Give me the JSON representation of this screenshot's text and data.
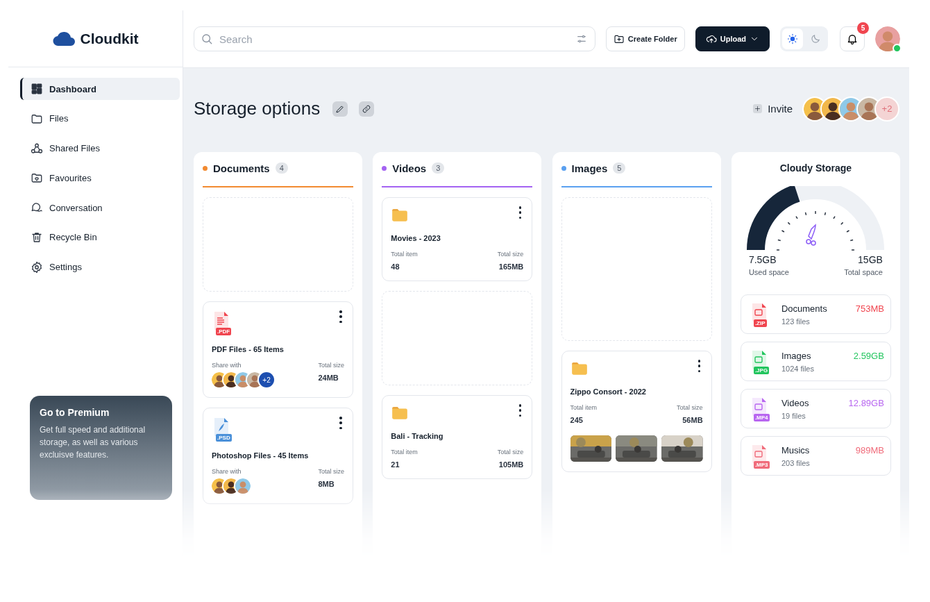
{
  "brand": {
    "name": "Cloudkit"
  },
  "sidebar": {
    "items": [
      {
        "label": "Dashboard",
        "selected": true
      },
      {
        "label": "Files",
        "selected": false
      },
      {
        "label": "Shared Files",
        "selected": false
      },
      {
        "label": "Favourites",
        "selected": false
      },
      {
        "label": "Conversation",
        "selected": false
      },
      {
        "label": "Recycle Bin",
        "selected": false
      },
      {
        "label": "Settings",
        "selected": false
      }
    ]
  },
  "premium": {
    "title": "Go to Premium",
    "text": "Get full speed and additional storage, as well as various excluisve features."
  },
  "search": {
    "placeholder": "Search"
  },
  "actions": [
    {
      "kind": "outline",
      "label": "Create Folder"
    },
    {
      "kind": "primary",
      "label": "Upload"
    }
  ],
  "theme": {
    "options": [
      {
        "kind": "light",
        "selected": true
      },
      {
        "kind": "dark",
        "selected": false
      }
    ]
  },
  "notifications": {
    "count": "5"
  },
  "user": {
    "online": true
  },
  "page": {
    "title": "Storage options",
    "invite": "Invite",
    "members": [
      {
        "kind": "avatar"
      },
      {
        "kind": "avatar"
      },
      {
        "kind": "avatar"
      },
      {
        "kind": "avatar"
      }
    ],
    "more_members": "+2"
  },
  "columns": [
    {
      "title": "Documents",
      "count": "4",
      "color": "#f28a30",
      "cards": [
        {
          "kind": "empty"
        },
        {
          "kind": "pdf",
          "badge": ".PDF",
          "name": "PDF Files - 65 Items",
          "share_label": "Share with",
          "avatars": [
            {
              "kind": "avatar"
            },
            {
              "kind": "avatar"
            },
            {
              "kind": "avatar"
            },
            {
              "kind": "avatar"
            }
          ],
          "more": "+2",
          "size_label": "Total size",
          "size": "24MB"
        },
        {
          "kind": "psd",
          "badge": ".PSD",
          "name": "Photoshop Files - 45 Items",
          "share_label": "Share with",
          "avatars": [
            {
              "kind": "avatar"
            },
            {
              "kind": "avatar"
            },
            {
              "kind": "avatar"
            }
          ],
          "size_label": "Total size",
          "size": "8MB"
        }
      ]
    },
    {
      "title": "Videos",
      "count": "3",
      "color": "#a463f2",
      "cards": [
        {
          "kind": "folder",
          "name": "Movies - 2023",
          "items_label": "Total item",
          "items": "48",
          "size_label": "Total size",
          "size": "165MB"
        },
        {
          "kind": "empty"
        },
        {
          "kind": "folder",
          "name": "Bali - Tracking",
          "items_label": "Total item",
          "items": "21",
          "size_label": "Total size",
          "size": "105MB"
        }
      ]
    },
    {
      "title": "Images",
      "count": "5",
      "color": "#5aa0f0",
      "cards": [
        {
          "kind": "empty"
        },
        {
          "kind": "folder",
          "name": "Zippo Consort - 2022",
          "items_label": "Total item",
          "items": "245",
          "size_label": "Total size",
          "size": "56MB"
        }
      ]
    }
  ],
  "storage": {
    "title": "Cloudy Storage",
    "gauge": {
      "level": 0.4
    },
    "used": "7.5GB",
    "used_label": "Used space",
    "total": "15GB",
    "total_label": "Total space",
    "items": [
      {
        "name": "Documents",
        "files": "123 files",
        "size": "753MB",
        "badge": ".ZIP",
        "color": "#f0454f"
      },
      {
        "name": "Images",
        "files": "1024 files",
        "size": "2.59GB",
        "badge": ".JPG",
        "color": "#22c55e"
      },
      {
        "name": "Videos",
        "files": "19 files",
        "size": "12.89GB",
        "badge": ".MP4",
        "color": "#b866f0"
      },
      {
        "name": "Musics",
        "files": "203 files",
        "size": "989MB",
        "badge": ".MP3",
        "color": "#f06b7a"
      }
    ]
  }
}
